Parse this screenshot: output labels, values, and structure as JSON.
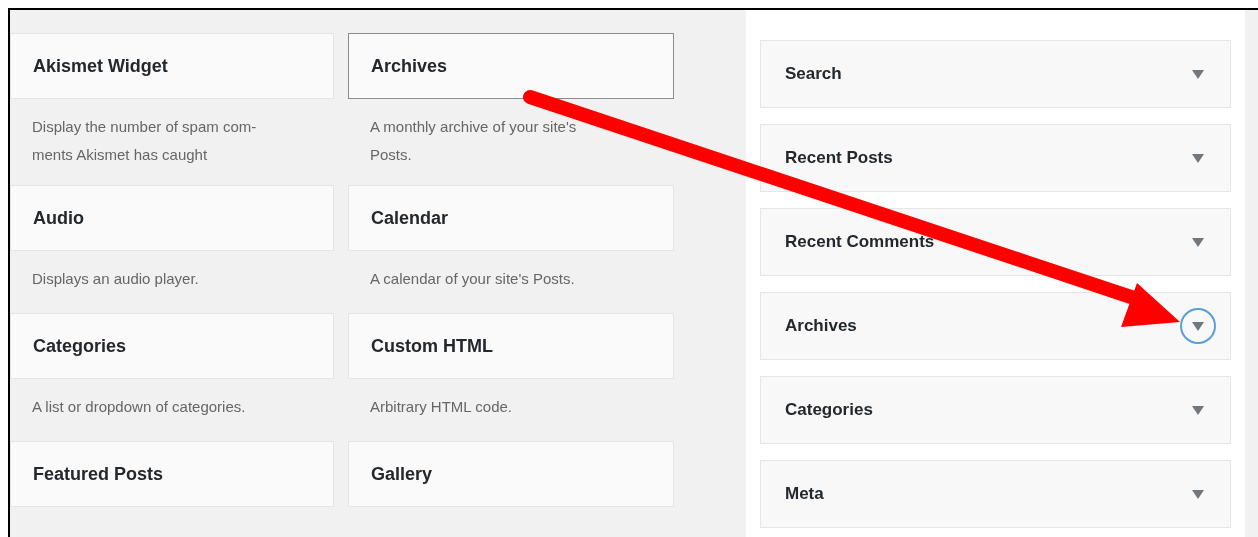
{
  "available_widgets": [
    {
      "title": "Akismet Widget",
      "description": "Display the number of spam com-ments Akismet has caught",
      "selected": false
    },
    {
      "title": "Archives",
      "description": "A monthly archive of your site's Posts.",
      "selected": true
    },
    {
      "title": "Audio",
      "description": "Displays an audio player.",
      "selected": false
    },
    {
      "title": "Calendar",
      "description": "A calendar of your site's Posts.",
      "selected": false
    },
    {
      "title": "Categories",
      "description": "A list or dropdown of categories.",
      "selected": false
    },
    {
      "title": "Custom HTML",
      "description": "Arbitrary HTML code.",
      "selected": false
    },
    {
      "title": "Featured Posts",
      "selected": false
    },
    {
      "title": "Gallery",
      "selected": false
    }
  ],
  "sidebar_widgets": [
    {
      "title": "Search",
      "focused": false
    },
    {
      "title": "Recent Posts",
      "focused": false
    },
    {
      "title": "Recent Comments",
      "focused": false
    },
    {
      "title": "Archives",
      "focused": true
    },
    {
      "title": "Categories",
      "focused": false
    },
    {
      "title": "Meta",
      "focused": false
    }
  ]
}
